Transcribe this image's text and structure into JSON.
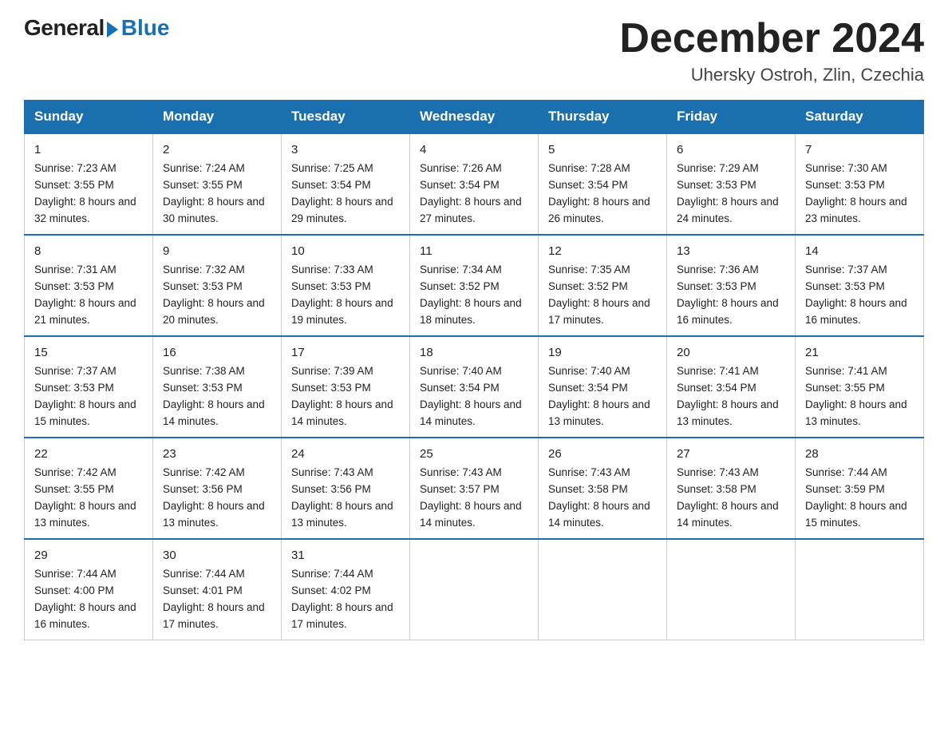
{
  "logo": {
    "general": "General",
    "blue": "Blue"
  },
  "title": "December 2024",
  "location": "Uhersky Ostroh, Zlin, Czechia",
  "days_of_week": [
    "Sunday",
    "Monday",
    "Tuesday",
    "Wednesday",
    "Thursday",
    "Friday",
    "Saturday"
  ],
  "weeks": [
    [
      {
        "day": "1",
        "sunrise": "7:23 AM",
        "sunset": "3:55 PM",
        "daylight": "8 hours and 32 minutes."
      },
      {
        "day": "2",
        "sunrise": "7:24 AM",
        "sunset": "3:55 PM",
        "daylight": "8 hours and 30 minutes."
      },
      {
        "day": "3",
        "sunrise": "7:25 AM",
        "sunset": "3:54 PM",
        "daylight": "8 hours and 29 minutes."
      },
      {
        "day": "4",
        "sunrise": "7:26 AM",
        "sunset": "3:54 PM",
        "daylight": "8 hours and 27 minutes."
      },
      {
        "day": "5",
        "sunrise": "7:28 AM",
        "sunset": "3:54 PM",
        "daylight": "8 hours and 26 minutes."
      },
      {
        "day": "6",
        "sunrise": "7:29 AM",
        "sunset": "3:53 PM",
        "daylight": "8 hours and 24 minutes."
      },
      {
        "day": "7",
        "sunrise": "7:30 AM",
        "sunset": "3:53 PM",
        "daylight": "8 hours and 23 minutes."
      }
    ],
    [
      {
        "day": "8",
        "sunrise": "7:31 AM",
        "sunset": "3:53 PM",
        "daylight": "8 hours and 21 minutes."
      },
      {
        "day": "9",
        "sunrise": "7:32 AM",
        "sunset": "3:53 PM",
        "daylight": "8 hours and 20 minutes."
      },
      {
        "day": "10",
        "sunrise": "7:33 AM",
        "sunset": "3:53 PM",
        "daylight": "8 hours and 19 minutes."
      },
      {
        "day": "11",
        "sunrise": "7:34 AM",
        "sunset": "3:52 PM",
        "daylight": "8 hours and 18 minutes."
      },
      {
        "day": "12",
        "sunrise": "7:35 AM",
        "sunset": "3:52 PM",
        "daylight": "8 hours and 17 minutes."
      },
      {
        "day": "13",
        "sunrise": "7:36 AM",
        "sunset": "3:53 PM",
        "daylight": "8 hours and 16 minutes."
      },
      {
        "day": "14",
        "sunrise": "7:37 AM",
        "sunset": "3:53 PM",
        "daylight": "8 hours and 16 minutes."
      }
    ],
    [
      {
        "day": "15",
        "sunrise": "7:37 AM",
        "sunset": "3:53 PM",
        "daylight": "8 hours and 15 minutes."
      },
      {
        "day": "16",
        "sunrise": "7:38 AM",
        "sunset": "3:53 PM",
        "daylight": "8 hours and 14 minutes."
      },
      {
        "day": "17",
        "sunrise": "7:39 AM",
        "sunset": "3:53 PM",
        "daylight": "8 hours and 14 minutes."
      },
      {
        "day": "18",
        "sunrise": "7:40 AM",
        "sunset": "3:54 PM",
        "daylight": "8 hours and 14 minutes."
      },
      {
        "day": "19",
        "sunrise": "7:40 AM",
        "sunset": "3:54 PM",
        "daylight": "8 hours and 13 minutes."
      },
      {
        "day": "20",
        "sunrise": "7:41 AM",
        "sunset": "3:54 PM",
        "daylight": "8 hours and 13 minutes."
      },
      {
        "day": "21",
        "sunrise": "7:41 AM",
        "sunset": "3:55 PM",
        "daylight": "8 hours and 13 minutes."
      }
    ],
    [
      {
        "day": "22",
        "sunrise": "7:42 AM",
        "sunset": "3:55 PM",
        "daylight": "8 hours and 13 minutes."
      },
      {
        "day": "23",
        "sunrise": "7:42 AM",
        "sunset": "3:56 PM",
        "daylight": "8 hours and 13 minutes."
      },
      {
        "day": "24",
        "sunrise": "7:43 AM",
        "sunset": "3:56 PM",
        "daylight": "8 hours and 13 minutes."
      },
      {
        "day": "25",
        "sunrise": "7:43 AM",
        "sunset": "3:57 PM",
        "daylight": "8 hours and 14 minutes."
      },
      {
        "day": "26",
        "sunrise": "7:43 AM",
        "sunset": "3:58 PM",
        "daylight": "8 hours and 14 minutes."
      },
      {
        "day": "27",
        "sunrise": "7:43 AM",
        "sunset": "3:58 PM",
        "daylight": "8 hours and 14 minutes."
      },
      {
        "day": "28",
        "sunrise": "7:44 AM",
        "sunset": "3:59 PM",
        "daylight": "8 hours and 15 minutes."
      }
    ],
    [
      {
        "day": "29",
        "sunrise": "7:44 AM",
        "sunset": "4:00 PM",
        "daylight": "8 hours and 16 minutes."
      },
      {
        "day": "30",
        "sunrise": "7:44 AM",
        "sunset": "4:01 PM",
        "daylight": "8 hours and 17 minutes."
      },
      {
        "day": "31",
        "sunrise": "7:44 AM",
        "sunset": "4:02 PM",
        "daylight": "8 hours and 17 minutes."
      },
      null,
      null,
      null,
      null
    ]
  ]
}
